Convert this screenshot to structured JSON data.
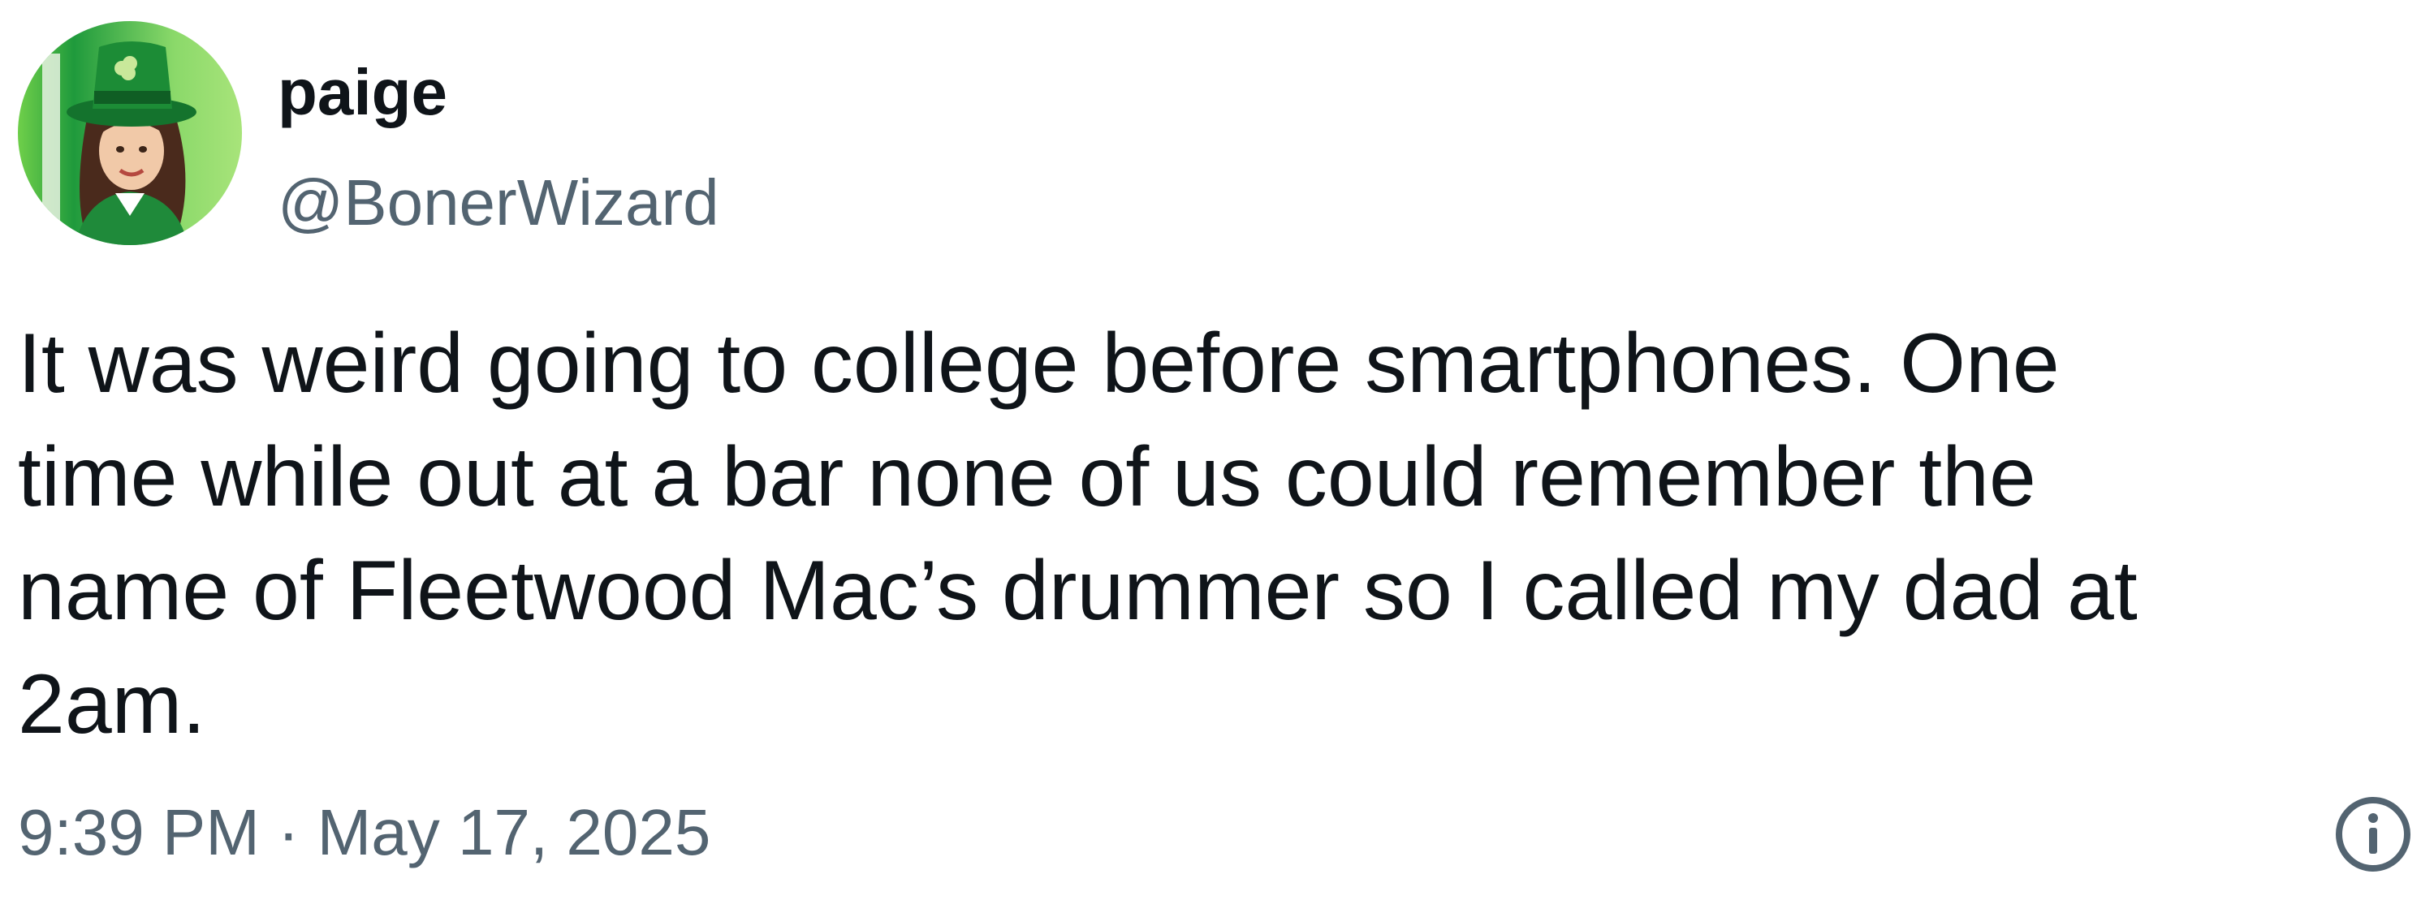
{
  "author": {
    "display_name": "paige",
    "handle": "@BonerWizard",
    "avatar_icon": "leprechaun-avatar"
  },
  "tweet": {
    "lines": [
      "It was weird going to college before smartphones. One",
      "time while out at a bar none of us could remember the",
      "name of Fleetwood Mac’s drummer so I called my dad at",
      "2am."
    ]
  },
  "meta": {
    "time": "9:39 PM",
    "separator": "·",
    "date": "May 17, 2025",
    "info_icon": "info-icon"
  },
  "colors": {
    "text_primary": "#0f1419",
    "text_secondary": "#536471",
    "avatar_green": "#1e8f3a"
  }
}
